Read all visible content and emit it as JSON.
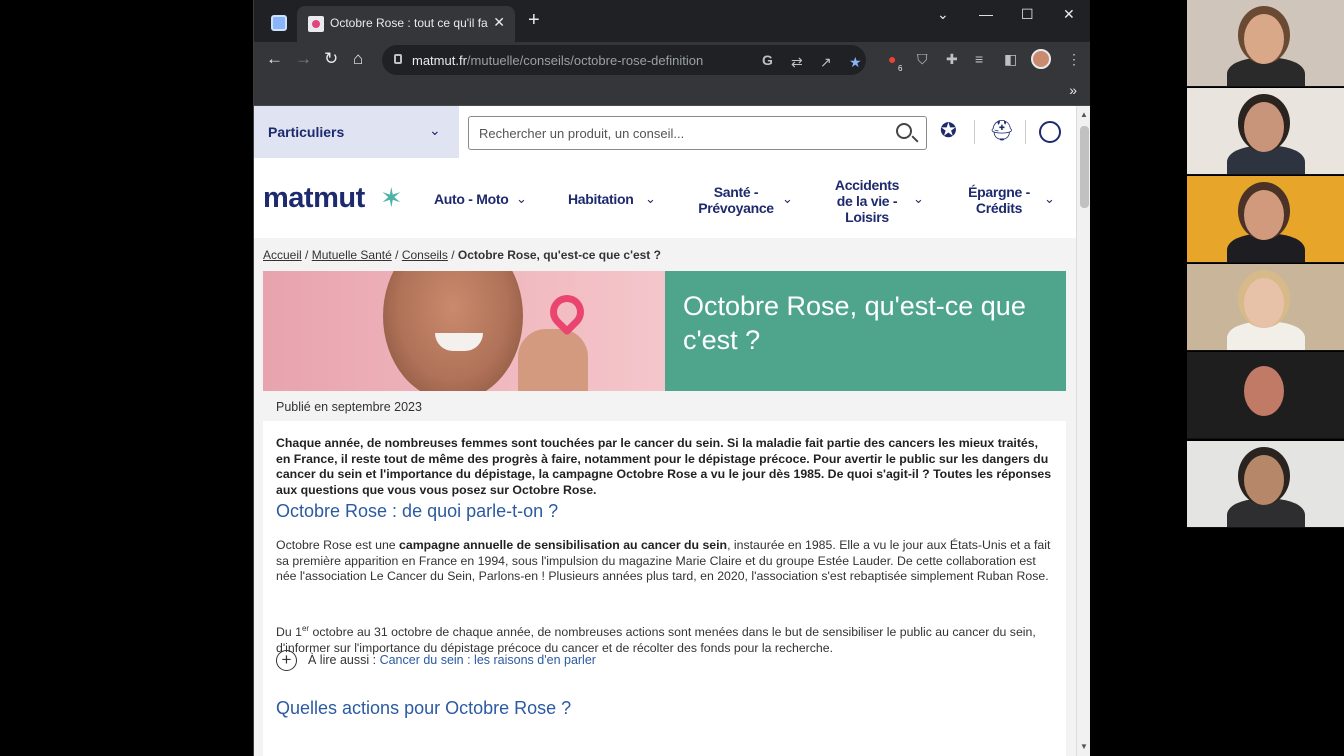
{
  "browser": {
    "active_tab_title": "Octobre Rose : tout ce qu'il faut",
    "tab_close": "✕",
    "new_tab": "+",
    "window_controls": [
      "⌄",
      "—",
      "☐",
      "✕"
    ],
    "url_domain": "matmut.fr",
    "url_path": "/mutuelle/conseils/octobre-rose-definition",
    "bookmarks_more": "»",
    "extension_badge": "6"
  },
  "site": {
    "segment_label": "Particuliers",
    "search_placeholder": "Rechercher un produit, un conseil...",
    "logo_text": "matmut",
    "nav": [
      {
        "label": "Auto - Moto"
      },
      {
        "label": "Habitation"
      },
      {
        "label": "Santé -\nPrévoyance"
      },
      {
        "label": "Accidents\nde la vie -\nLoisirs"
      },
      {
        "label": "Épargne -\nCrédits"
      }
    ]
  },
  "breadcrumb": {
    "items": [
      "Accueil",
      "Mutuelle Santé",
      "Conseils"
    ],
    "separator": "/",
    "current": "Octobre Rose, qu'est-ce que c'est ?"
  },
  "article": {
    "title": "Octobre Rose, qu'est-ce que c'est ?",
    "published": "Publié en septembre 2023",
    "intro": "Chaque année, de nombreuses femmes sont touchées par le cancer du sein. Si la maladie fait partie des cancers les mieux traités, en France, il reste tout de même des progrès à faire, notamment pour le dépistage précoce. Pour avertir le public sur les dangers du cancer du sein et l'importance du dépistage, la campagne Octobre Rose a vu le jour dès 1985. De quoi s'agit-il ? Toutes les réponses aux questions que vous vous posez sur Octobre Rose.",
    "h2_1": "Octobre Rose : de quoi parle-t-on ?",
    "p1_a": "Octobre Rose est une ",
    "p1_bold": "campagne annuelle de sensibilisation au cancer du sein",
    "p1_b": ", instaurée en 1985. Elle a vu le jour aux États-Unis et a fait sa première apparition en France en 1994, sous l'impulsion du magazine Marie Claire et du groupe Estée Lauder. De cette collaboration est née l'association Le Cancer du Sein, Parlons-en ! Plusieurs années plus tard, en 2020, l'association s'est rebaptisée simplement Ruban Rose.",
    "p2_a": "Du 1",
    "p2_sup": "er",
    "p2_b": " octobre au 31 octobre de chaque année, de nombreuses actions sont menées dans le but de sensibiliser le public au cancer du sein, d'informer sur l'importance du dépistage précoce du cancer et de récolter des fonds pour la recherche.",
    "read_also_label": "À lire aussi : ",
    "read_also_link": "Cancer du sein : les raisons d'en parler",
    "h2_2": "Quelles actions pour Octobre Rose ?"
  },
  "colors": {
    "brand_navy": "#1d2a6e",
    "hero_green": "#4fa58c",
    "link_blue": "#2b5aa3"
  },
  "participants": [
    {
      "name": "participant-1",
      "bg": "#cfc5ba",
      "skin": "#d9a888",
      "shirt": "#2a2a2a",
      "hair": "#6b4a33"
    },
    {
      "name": "participant-2",
      "bg": "#e9e4de",
      "skin": "#c8957a",
      "shirt": "#2d3440",
      "hair": "#2b2320"
    },
    {
      "name": "participant-3",
      "bg": "#e7a62a",
      "skin": "#d29a7c",
      "shirt": "#1e1e22",
      "hair": "#4a3226"
    },
    {
      "name": "participant-4",
      "bg": "#c9b59a",
      "skin": "#e8c2a8",
      "shirt": "#f2efe9",
      "hair": "#d7b98a"
    },
    {
      "name": "participant-5",
      "bg": "#1e1e1e",
      "skin": "#c07a66",
      "shirt": "#1e1e1e",
      "hair": "#1e1e1e"
    },
    {
      "name": "participant-6",
      "bg": "#e4e4e2",
      "skin": "#b7876a",
      "shirt": "#2e2e30",
      "hair": "#2a2420"
    }
  ]
}
